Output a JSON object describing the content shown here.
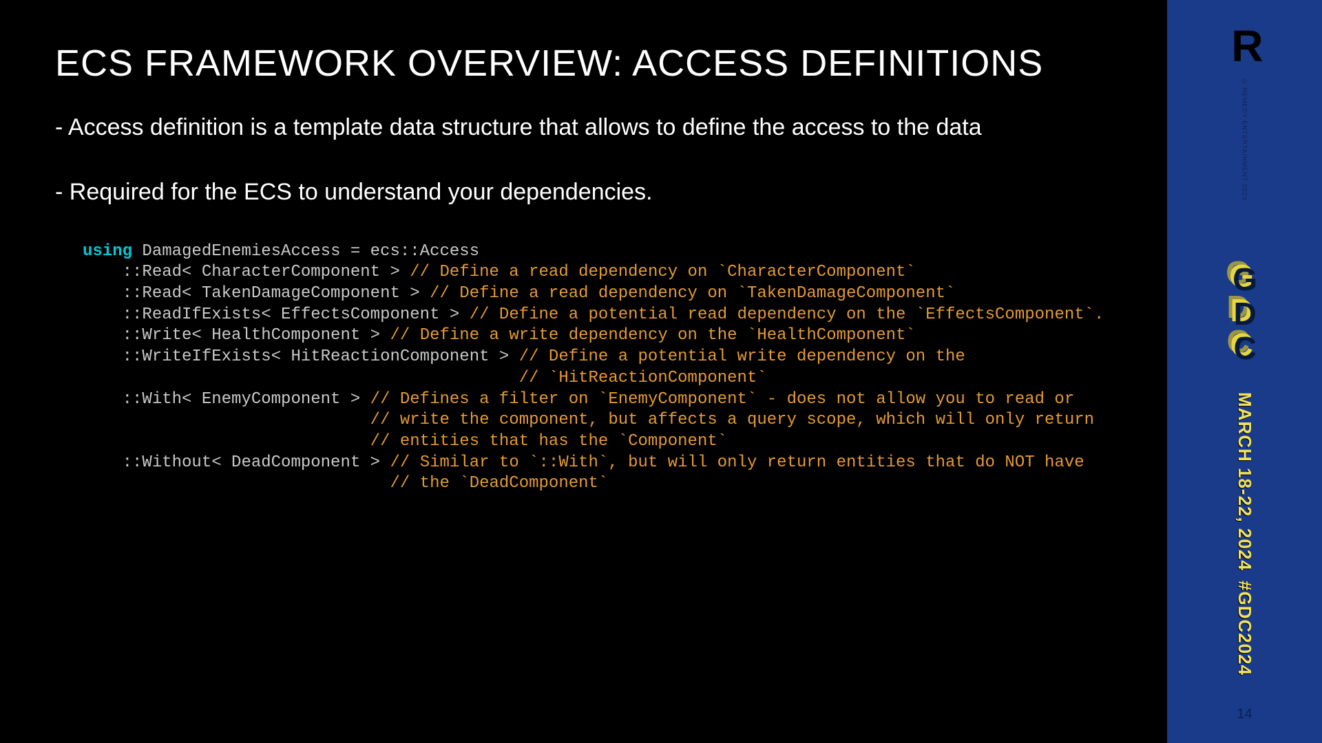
{
  "title": "ECS FRAMEWORK OVERVIEW: ACCESS DEFINITIONS",
  "bullets": [
    "- Access definition is a template data structure that allows to define the access to the data",
    "- Required for the ECS to understand your dependencies."
  ],
  "code": {
    "kw": "using",
    "l1a": " DamagedEnemiesAccess = ecs::Access",
    "l2a": "    ::Read< CharacterComponent > ",
    "l2c": "// Define a read dependency on `CharacterComponent`",
    "l3a": "    ::Read< TakenDamageComponent > ",
    "l3c": "// Define a read dependency on `TakenDamageComponent`",
    "l4a": "    ::ReadIfExists< EffectsComponent > ",
    "l4c": "// Define a potential read dependency on the `EffectsComponent`.",
    "l5a": "    ::Write< HealthComponent > ",
    "l5c": "// Define a write dependency on the `HealthComponent`",
    "l6a": "    ::WriteIfExists< HitReactionComponent > ",
    "l6c": "// Define a potential write dependency on the",
    "l6d": "                                            // `HitReactionComponent`",
    "l7a": "    ::With< EnemyComponent > ",
    "l7c": "// Defines a filter on `EnemyComponent` - does not allow you to read or",
    "l7d": "                             // write the component, but affects a query scope, which will only return",
    "l7e": "                             // entities that has the `Component`",
    "l8a": "    ::Without< DeadComponent > ",
    "l8c": "// Similar to `::With`, but will only return entities that do NOT have",
    "l8d": "                               // the `DeadComponent`"
  },
  "sidebar": {
    "logo": "R",
    "copyright": "© REMEDY ENTERTAINMENT 2023",
    "gdc": "GDC",
    "date": "MARCH 18-22, 2024",
    "hash": "#GDC2024",
    "page": "14"
  }
}
